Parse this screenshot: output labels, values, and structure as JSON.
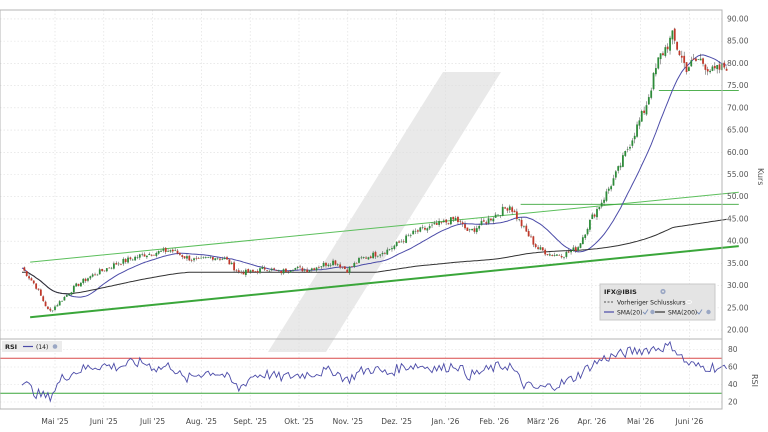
{
  "chart_data": [
    {
      "type": "line",
      "title": "",
      "ylabel": "Kurs",
      "ylim": [
        18,
        92
      ],
      "y_ticks": [
        20,
        25,
        30,
        35,
        40,
        45,
        50,
        55,
        60,
        65,
        70,
        75,
        80,
        85,
        90
      ],
      "y_tick_labels": [
        "20.00",
        "25.00",
        "30.00",
        "35.00",
        "40.00",
        "45.00",
        "50.00",
        "55.00",
        "60.00",
        "65.00",
        "70.00",
        "75.00",
        "80.00",
        "85.00",
        "90.00"
      ],
      "x_tick_labels": [
        "Mai '25",
        "Juni '25",
        "Juli '25",
        "Aug. '25",
        "Sept. '25",
        "Okt. '25",
        "Nov. '25",
        "Dez. '25",
        "Jan. '26",
        "Feb. '26",
        "März '26",
        "Apr. '26",
        "Mai '26",
        "Juni '26"
      ],
      "grid": true,
      "legend_position": "bottom-right",
      "legend": {
        "title": "IFX@IBIS",
        "entries": [
          "Vorheriger Schlusskurs",
          "SMA(20)",
          "SMA(200)"
        ]
      },
      "series": [
        {
          "name": "IFX@IBIS",
          "style": "candlestick",
          "up_color": "#2e8b3a",
          "down_color": "#c0392b",
          "close_path": [
            [
              0,
              34
            ],
            [
              1,
              30
            ],
            [
              2,
              24
            ],
            [
              3,
              27
            ],
            [
              4,
              30
            ],
            [
              5,
              32
            ],
            [
              6,
              33.5
            ],
            [
              7,
              35
            ],
            [
              8,
              36
            ],
            [
              9,
              37
            ],
            [
              10,
              37.5
            ],
            [
              11,
              38
            ],
            [
              12,
              36.5
            ],
            [
              13,
              35.5
            ],
            [
              14,
              36.5
            ],
            [
              15,
              36
            ],
            [
              16,
              33
            ],
            [
              17,
              33
            ],
            [
              18,
              34
            ],
            [
              19,
              33
            ],
            [
              20,
              34
            ],
            [
              21,
              33.5
            ],
            [
              22,
              34.5
            ],
            [
              23,
              35.5
            ],
            [
              24,
              33.5
            ],
            [
              25,
              36
            ],
            [
              26,
              37
            ],
            [
              27,
              38
            ],
            [
              28,
              40
            ],
            [
              29,
              42
            ],
            [
              30,
              43
            ],
            [
              31,
              44
            ],
            [
              32,
              45
            ],
            [
              33,
              42
            ],
            [
              34,
              44
            ],
            [
              35,
              46
            ],
            [
              36,
              48
            ],
            [
              37,
              43
            ],
            [
              38,
              38.5
            ],
            [
              39,
              37
            ],
            [
              40,
              37
            ],
            [
              41,
              38.5
            ],
            [
              42,
              45
            ],
            [
              43,
              50
            ],
            [
              44,
              56
            ],
            [
              45,
              63
            ],
            [
              46,
              70
            ],
            [
              47,
              81
            ],
            [
              48,
              86
            ],
            [
              49,
              79
            ],
            [
              50,
              81
            ],
            [
              51,
              78
            ],
            [
              52,
              79.5
            ]
          ]
        },
        {
          "name": "SMA(20)",
          "color": "#4b4ba8"
        },
        {
          "name": "SMA(200)",
          "color": "#333333"
        }
      ],
      "annotations": [
        {
          "kind": "trendline",
          "color": "#5cbf5c",
          "points": [
            [
              0.6,
              35.3
            ],
            [
              52.9,
              51
            ]
          ]
        },
        {
          "kind": "trendline",
          "color": "#3aa63a",
          "points": [
            [
              0.6,
              22.9
            ],
            [
              52.9,
              38.9
            ]
          ]
        },
        {
          "kind": "horizontal",
          "color": "#3aa63a",
          "y": 48.3,
          "from": 36.8,
          "to": 52.9
        },
        {
          "kind": "horizontal",
          "color": "#3aa63a",
          "y": 73.9,
          "from": 47,
          "to": 52.9
        }
      ]
    },
    {
      "type": "line",
      "title": "RSI",
      "ylabel": "RSI",
      "ylim": [
        12,
        92
      ],
      "y_ticks": [
        20,
        40,
        60,
        80
      ],
      "y_tick_labels": [
        "20",
        "40",
        "60",
        "80"
      ],
      "reference_lines": [
        30,
        70
      ],
      "legend": {
        "entries": [
          "(14)"
        ]
      },
      "series": [
        {
          "name": "(14)",
          "color": "#4b4ba8",
          "path": [
            [
              0,
              45
            ],
            [
              1,
              30
            ],
            [
              2,
              25
            ],
            [
              3,
              48
            ],
            [
              4,
              55
            ],
            [
              5,
              60
            ],
            [
              6,
              62
            ],
            [
              7,
              60
            ],
            [
              8,
              64
            ],
            [
              9,
              65
            ],
            [
              10,
              58
            ],
            [
              11,
              62
            ],
            [
              12,
              45
            ],
            [
              13,
              52
            ],
            [
              14,
              55
            ],
            [
              15,
              50
            ],
            [
              16,
              35
            ],
            [
              17,
              50
            ],
            [
              18,
              52
            ],
            [
              19,
              48
            ],
            [
              20,
              50
            ],
            [
              21,
              52
            ],
            [
              22,
              54
            ],
            [
              23,
              56
            ],
            [
              24,
              45
            ],
            [
              25,
              55
            ],
            [
              26,
              58
            ],
            [
              27,
              52
            ],
            [
              28,
              60
            ],
            [
              29,
              62
            ],
            [
              30,
              60
            ],
            [
              31,
              58
            ],
            [
              32,
              63
            ],
            [
              33,
              50
            ],
            [
              34,
              55
            ],
            [
              35,
              60
            ],
            [
              36,
              62
            ],
            [
              37,
              40
            ],
            [
              38,
              35
            ],
            [
              39,
              38
            ],
            [
              40,
              42
            ],
            [
              41,
              50
            ],
            [
              42,
              62
            ],
            [
              43,
              70
            ],
            [
              44,
              74
            ],
            [
              45,
              78
            ],
            [
              46,
              80
            ],
            [
              47,
              82
            ],
            [
              48,
              84
            ],
            [
              49,
              65
            ],
            [
              50,
              60
            ],
            [
              51,
              60
            ],
            [
              52,
              57
            ]
          ]
        }
      ]
    }
  ]
}
